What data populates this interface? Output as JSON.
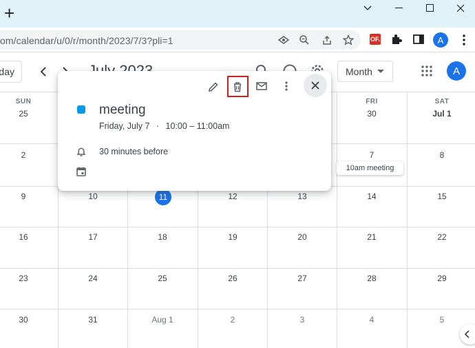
{
  "browser": {
    "new_tab": "+",
    "url": "om/calendar/u/0/r/month/2023/7/3?pli=1",
    "ext_badge": "OF.",
    "profile_initial": "A"
  },
  "header": {
    "today_label": "day",
    "title": "July 2023",
    "view_label": "Month",
    "avatar_initial": "A"
  },
  "weekdays": [
    "SUN",
    "",
    "",
    "",
    "",
    "FRI",
    "SAT"
  ],
  "weeks": [
    [
      "25",
      "",
      "",
      "",
      "",
      "30",
      "Jul 1"
    ],
    [
      "2",
      "",
      "",
      "",
      "",
      "7",
      "8"
    ],
    [
      "9",
      "10",
      "11",
      "12",
      "13",
      "14",
      "15"
    ],
    [
      "16",
      "17",
      "18",
      "19",
      "20",
      "21",
      "22"
    ],
    [
      "23",
      "24",
      "25",
      "26",
      "27",
      "28",
      "29"
    ],
    [
      "30",
      "31",
      "Aug 1",
      "2",
      "3",
      "4",
      "5"
    ]
  ],
  "event_chip": "10am meeting",
  "popup": {
    "title": "meeting",
    "date": "Friday, July 7",
    "separator": "·",
    "time": "10:00 – 11:00am",
    "notification": "30 minutes before",
    "event_color": "#039be5"
  },
  "colors": {
    "accent": "#1a73e8",
    "highlight_box": "#d21f1f",
    "titlebar": "#dff3f8"
  }
}
